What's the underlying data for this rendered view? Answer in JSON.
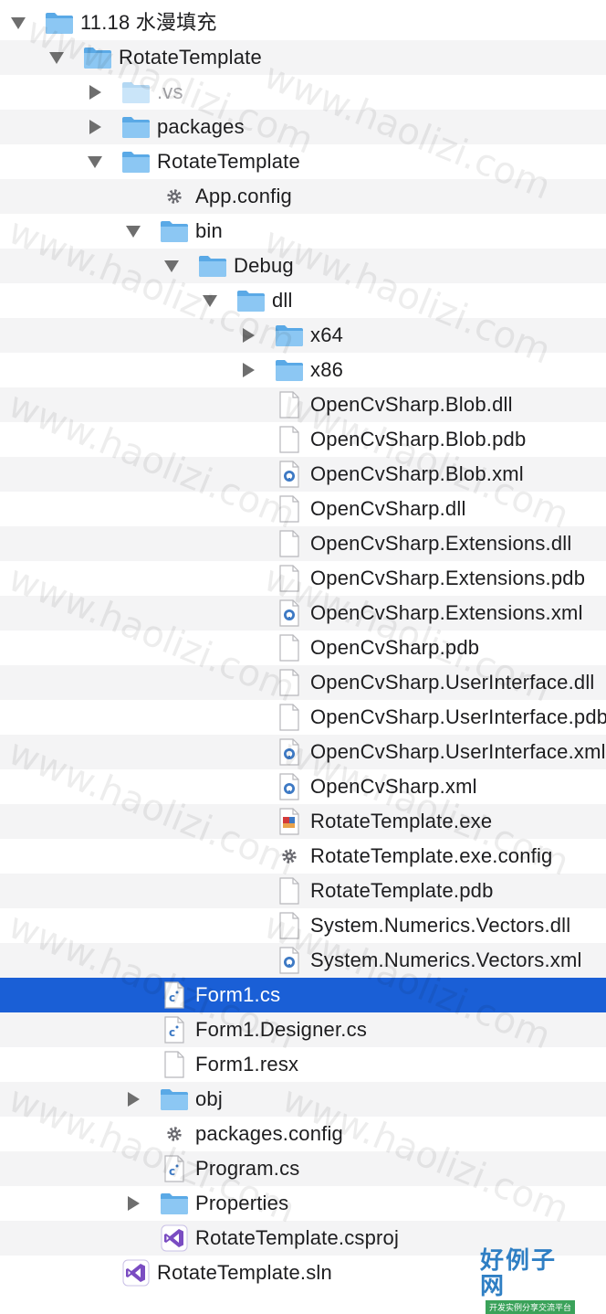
{
  "watermark": "www.haolizi.com",
  "logo": {
    "main": "好例子网",
    "sub": "开发实例分享交流平台"
  },
  "rows": [
    {
      "label": "11.18 水漫填充",
      "icon": "folder-icon",
      "depth": 0,
      "disclosure": "expanded"
    },
    {
      "label": "RotateTemplate",
      "icon": "folder-icon",
      "depth": 1,
      "disclosure": "expanded"
    },
    {
      "label": ".vs",
      "icon": "folder-icon",
      "depth": 2,
      "disclosure": "collapsed",
      "dim": true
    },
    {
      "label": "packages",
      "icon": "folder-icon",
      "depth": 2,
      "disclosure": "collapsed"
    },
    {
      "label": "RotateTemplate",
      "icon": "folder-icon",
      "depth": 2,
      "disclosure": "expanded"
    },
    {
      "label": "App.config",
      "icon": "gear-icon",
      "depth": 3,
      "disclosure": "none"
    },
    {
      "label": "bin",
      "icon": "folder-icon",
      "depth": 3,
      "disclosure": "expanded"
    },
    {
      "label": "Debug",
      "icon": "folder-icon",
      "depth": 4,
      "disclosure": "expanded"
    },
    {
      "label": "dll",
      "icon": "folder-icon",
      "depth": 5,
      "disclosure": "expanded"
    },
    {
      "label": "x64",
      "icon": "folder-icon",
      "depth": 6,
      "disclosure": "collapsed"
    },
    {
      "label": "x86",
      "icon": "folder-icon",
      "depth": 6,
      "disclosure": "collapsed"
    },
    {
      "label": "OpenCvSharp.Blob.dll",
      "icon": "document-icon",
      "depth": 6,
      "disclosure": "none"
    },
    {
      "label": "OpenCvSharp.Blob.pdb",
      "icon": "document-icon",
      "depth": 6,
      "disclosure": "none"
    },
    {
      "label": "OpenCvSharp.Blob.xml",
      "icon": "xml-file-icon",
      "depth": 6,
      "disclosure": "none"
    },
    {
      "label": "OpenCvSharp.dll",
      "icon": "document-icon",
      "depth": 6,
      "disclosure": "none"
    },
    {
      "label": "OpenCvSharp.Extensions.dll",
      "icon": "document-icon",
      "depth": 6,
      "disclosure": "none"
    },
    {
      "label": "OpenCvSharp.Extensions.pdb",
      "icon": "document-icon",
      "depth": 6,
      "disclosure": "none"
    },
    {
      "label": "OpenCvSharp.Extensions.xml",
      "icon": "xml-file-icon",
      "depth": 6,
      "disclosure": "none"
    },
    {
      "label": "OpenCvSharp.pdb",
      "icon": "document-icon",
      "depth": 6,
      "disclosure": "none"
    },
    {
      "label": "OpenCvSharp.UserInterface.dll",
      "icon": "document-icon",
      "depth": 6,
      "disclosure": "none"
    },
    {
      "label": "OpenCvSharp.UserInterface.pdb",
      "icon": "document-icon",
      "depth": 6,
      "disclosure": "none"
    },
    {
      "label": "OpenCvSharp.UserInterface.xml",
      "icon": "xml-file-icon",
      "depth": 6,
      "disclosure": "none"
    },
    {
      "label": "OpenCvSharp.xml",
      "icon": "xml-file-icon",
      "depth": 6,
      "disclosure": "none"
    },
    {
      "label": "RotateTemplate.exe",
      "icon": "exe-file-icon",
      "depth": 6,
      "disclosure": "none"
    },
    {
      "label": "RotateTemplate.exe.config",
      "icon": "gear-icon",
      "depth": 6,
      "disclosure": "none"
    },
    {
      "label": "RotateTemplate.pdb",
      "icon": "document-icon",
      "depth": 6,
      "disclosure": "none"
    },
    {
      "label": "System.Numerics.Vectors.dll",
      "icon": "document-icon",
      "depth": 6,
      "disclosure": "none"
    },
    {
      "label": "System.Numerics.Vectors.xml",
      "icon": "xml-file-icon",
      "depth": 6,
      "disclosure": "none"
    },
    {
      "label": "Form1.cs",
      "icon": "csharp-file-icon",
      "depth": 3,
      "disclosure": "none",
      "selected": true
    },
    {
      "label": "Form1.Designer.cs",
      "icon": "csharp-file-icon",
      "depth": 3,
      "disclosure": "none"
    },
    {
      "label": "Form1.resx",
      "icon": "document-icon",
      "depth": 3,
      "disclosure": "none"
    },
    {
      "label": "obj",
      "icon": "folder-icon",
      "depth": 3,
      "disclosure": "collapsed"
    },
    {
      "label": "packages.config",
      "icon": "gear-icon",
      "depth": 3,
      "disclosure": "none"
    },
    {
      "label": "Program.cs",
      "icon": "csharp-file-icon",
      "depth": 3,
      "disclosure": "none"
    },
    {
      "label": "Properties",
      "icon": "folder-icon",
      "depth": 3,
      "disclosure": "collapsed"
    },
    {
      "label": "RotateTemplate.csproj",
      "icon": "visual-studio-icon",
      "depth": 3,
      "disclosure": "none"
    },
    {
      "label": "RotateTemplate.sln",
      "icon": "visual-studio-icon",
      "depth": 2,
      "disclosure": "none"
    }
  ],
  "colors": {
    "selection": "#1a5fd6",
    "folder": "#62b3ee",
    "stripe": "#f4f4f5"
  }
}
